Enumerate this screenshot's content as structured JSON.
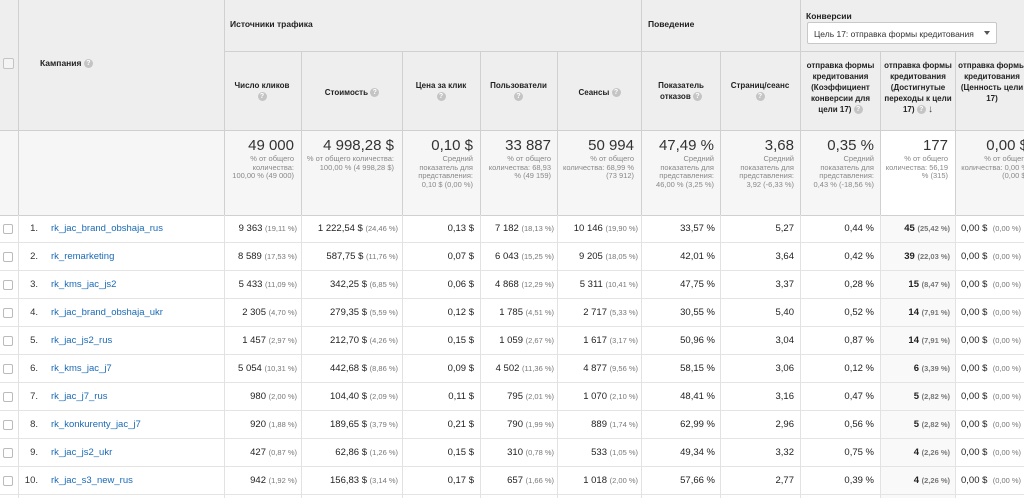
{
  "header": {
    "checkbox_label": "",
    "campaign": "Кампания",
    "group_traffic": "Источники трафика",
    "group_behavior": "Поведение",
    "group_conversions": "Конверсии",
    "goal_select": "Цель 17: отправка формы кредитования",
    "cols": {
      "clicks": "Число кликов",
      "cost": "Стоимость",
      "cpc": "Цена за клик",
      "users": "Пользователи",
      "sessions": "Сеансы",
      "bounce": "Показатель отказов",
      "pages": "Страниц/сеанс",
      "conv_rate": "отправка формы кредитования (Коэффициент конверсии для цели 17)",
      "completions": "отправка формы кредитования (Достигнутые переходы к цели 17)",
      "value": "отправка формы кредитования (Ценность цели 17)"
    }
  },
  "totals": {
    "clicks": {
      "big": "49 000",
      "sub": "% от общего количества: 100,00 % (49 000)"
    },
    "cost": {
      "big": "4 998,28 $",
      "sub": "% от общего количества: 100,00 % (4 998,28 $)"
    },
    "cpc": {
      "big": "0,10 $",
      "sub": "Средний показатель для представления: 0,10 $ (0,00 %)"
    },
    "users": {
      "big": "33 887",
      "sub": "% от общего количества: 68,93 % (49 159)"
    },
    "sessions": {
      "big": "50 994",
      "sub": "% от общего количества: 68,99 % (73 912)"
    },
    "bounce": {
      "big": "47,49 %",
      "sub": "Средний показатель для представления: 46,00 % (3,25 %)"
    },
    "pages": {
      "big": "3,68",
      "sub": "Средний показатель для представления: 3,92 (-6,33 %)"
    },
    "conv_rate": {
      "big": "0,35 %",
      "sub": "Средний показатель для представления: 0,43 % (-18,56 %)"
    },
    "completions": {
      "big": "177",
      "sub": "% от общего количества: 56,19 % (315)"
    },
    "value": {
      "big": "0,00 $",
      "sub": "% от общего количества: 0,00 % (0,00 $)"
    }
  },
  "rows": [
    {
      "n": "1.",
      "campaign": "rk_jac_brand_obshaja_rus",
      "clicks": "9 363",
      "clicks_pct": "(19,11 %)",
      "cost": "1 222,54 $",
      "cost_pct": "(24,46 %)",
      "cpc": "0,13 $",
      "users": "7 182",
      "users_pct": "(18,13 %)",
      "sessions": "10 146",
      "sessions_pct": "(19,90 %)",
      "bounce": "33,57 %",
      "pages": "5,27",
      "conv": "0,44 %",
      "comp": "45",
      "comp_pct": "(25,42 %)",
      "value": "0,00 $",
      "value_pct": "(0,00 %)"
    },
    {
      "n": "2.",
      "campaign": "rk_remarketing",
      "clicks": "8 589",
      "clicks_pct": "(17,53 %)",
      "cost": "587,75 $",
      "cost_pct": "(11,76 %)",
      "cpc": "0,07 $",
      "users": "6 043",
      "users_pct": "(15,25 %)",
      "sessions": "9 205",
      "sessions_pct": "(18,05 %)",
      "bounce": "42,01 %",
      "pages": "3,64",
      "conv": "0,42 %",
      "comp": "39",
      "comp_pct": "(22,03 %)",
      "value": "0,00 $",
      "value_pct": "(0,00 %)"
    },
    {
      "n": "3.",
      "campaign": "rk_kms_jac_js2",
      "clicks": "5 433",
      "clicks_pct": "(11,09 %)",
      "cost": "342,25 $",
      "cost_pct": "(6,85 %)",
      "cpc": "0,06 $",
      "users": "4 868",
      "users_pct": "(12,29 %)",
      "sessions": "5 311",
      "sessions_pct": "(10,41 %)",
      "bounce": "47,75 %",
      "pages": "3,37",
      "conv": "0,28 %",
      "comp": "15",
      "comp_pct": "(8,47 %)",
      "value": "0,00 $",
      "value_pct": "(0,00 %)"
    },
    {
      "n": "4.",
      "campaign": "rk_jac_brand_obshaja_ukr",
      "clicks": "2 305",
      "clicks_pct": "(4,70 %)",
      "cost": "279,35 $",
      "cost_pct": "(5,59 %)",
      "cpc": "0,12 $",
      "users": "1 785",
      "users_pct": "(4,51 %)",
      "sessions": "2 717",
      "sessions_pct": "(5,33 %)",
      "bounce": "30,55 %",
      "pages": "5,40",
      "conv": "0,52 %",
      "comp": "14",
      "comp_pct": "(7,91 %)",
      "value": "0,00 $",
      "value_pct": "(0,00 %)"
    },
    {
      "n": "5.",
      "campaign": "rk_jac_js2_rus",
      "clicks": "1 457",
      "clicks_pct": "(2,97 %)",
      "cost": "212,70 $",
      "cost_pct": "(4,26 %)",
      "cpc": "0,15 $",
      "users": "1 059",
      "users_pct": "(2,67 %)",
      "sessions": "1 617",
      "sessions_pct": "(3,17 %)",
      "bounce": "50,96 %",
      "pages": "3,04",
      "conv": "0,87 %",
      "comp": "14",
      "comp_pct": "(7,91 %)",
      "value": "0,00 $",
      "value_pct": "(0,00 %)"
    },
    {
      "n": "6.",
      "campaign": "rk_kms_jac_j7",
      "clicks": "5 054",
      "clicks_pct": "(10,31 %)",
      "cost": "442,68 $",
      "cost_pct": "(8,86 %)",
      "cpc": "0,09 $",
      "users": "4 502",
      "users_pct": "(11,36 %)",
      "sessions": "4 877",
      "sessions_pct": "(9,56 %)",
      "bounce": "58,15 %",
      "pages": "3,06",
      "conv": "0,12 %",
      "comp": "6",
      "comp_pct": "(3,39 %)",
      "value": "0,00 $",
      "value_pct": "(0,00 %)"
    },
    {
      "n": "7.",
      "campaign": "rk_jac_j7_rus",
      "clicks": "980",
      "clicks_pct": "(2,00 %)",
      "cost": "104,40 $",
      "cost_pct": "(2,09 %)",
      "cpc": "0,11 $",
      "users": "795",
      "users_pct": "(2,01 %)",
      "sessions": "1 070",
      "sessions_pct": "(2,10 %)",
      "bounce": "48,41 %",
      "pages": "3,16",
      "conv": "0,47 %",
      "comp": "5",
      "comp_pct": "(2,82 %)",
      "value": "0,00 $",
      "value_pct": "(0,00 %)"
    },
    {
      "n": "8.",
      "campaign": "rk_konkurenty_jac_j7",
      "clicks": "920",
      "clicks_pct": "(1,88 %)",
      "cost": "189,65 $",
      "cost_pct": "(3,79 %)",
      "cpc": "0,21 $",
      "users": "790",
      "users_pct": "(1,99 %)",
      "sessions": "889",
      "sessions_pct": "(1,74 %)",
      "bounce": "62,99 %",
      "pages": "2,96",
      "conv": "0,56 %",
      "comp": "5",
      "comp_pct": "(2,82 %)",
      "value": "0,00 $",
      "value_pct": "(0,00 %)"
    },
    {
      "n": "9.",
      "campaign": "rk_jac_js2_ukr",
      "clicks": "427",
      "clicks_pct": "(0,87 %)",
      "cost": "62,86 $",
      "cost_pct": "(1,26 %)",
      "cpc": "0,15 $",
      "users": "310",
      "users_pct": "(0,78 %)",
      "sessions": "533",
      "sessions_pct": "(1,05 %)",
      "bounce": "49,34 %",
      "pages": "3,32",
      "conv": "0,75 %",
      "comp": "4",
      "comp_pct": "(2,26 %)",
      "value": "0,00 $",
      "value_pct": "(0,00 %)"
    },
    {
      "n": "10.",
      "campaign": "rk_jac_s3_new_rus",
      "clicks": "942",
      "clicks_pct": "(1,92 %)",
      "cost": "156,83 $",
      "cost_pct": "(3,14 %)",
      "cpc": "0,17 $",
      "users": "657",
      "users_pct": "(1,66 %)",
      "sessions": "1 018",
      "sessions_pct": "(2,00 %)",
      "bounce": "57,66 %",
      "pages": "2,77",
      "conv": "0,39 %",
      "comp": "4",
      "comp_pct": "(2,26 %)",
      "value": "0,00 $",
      "value_pct": "(0,00 %)"
    }
  ]
}
